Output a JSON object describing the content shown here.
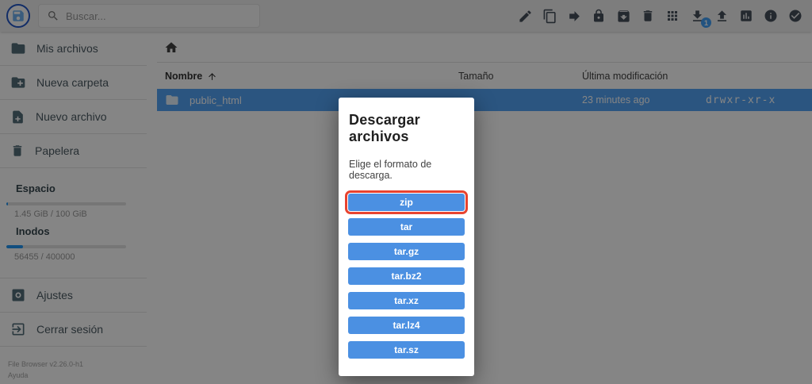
{
  "header": {
    "logo_icon": "floppy-disk-logo",
    "search": {
      "icon": "search-icon",
      "placeholder": "Buscar..."
    },
    "toolbar": {
      "icons": [
        "rename",
        "copy",
        "move",
        "lock",
        "archive",
        "delete",
        "view-grid",
        "download",
        "upload",
        "stats",
        "info",
        "select"
      ],
      "download_badge": "1"
    }
  },
  "sidebar": {
    "items": [
      {
        "icon": "folder-icon",
        "label": "Mis archivos"
      },
      {
        "icon": "new-folder-icon",
        "label": "Nueva carpeta"
      },
      {
        "icon": "new-file-icon",
        "label": "Nuevo archivo"
      },
      {
        "icon": "trash-icon",
        "label": "Papelera"
      }
    ],
    "usage": {
      "space_label": "Espacio",
      "space_value": "1.45 GiB / 100 GiB",
      "space_percent": 1.5,
      "inodes_label": "Inodos",
      "inodes_value": "56455 / 400000",
      "inodes_percent": 14.1
    },
    "settings_label": "Ajustes",
    "logout_label": "Cerrar sesión",
    "footer": {
      "version": "File Browser v2.26.0-h1",
      "help": "Ayuda"
    }
  },
  "listing": {
    "breadcrumb_icon": "home-icon",
    "columns": [
      "Nombre",
      "Tamaño",
      "Última modificación"
    ],
    "sort": {
      "column": "Nombre",
      "direction": "asc"
    },
    "rows": [
      {
        "icon": "folder-icon",
        "name": "public_html",
        "size": "",
        "modified": "23 minutes ago",
        "permissions": "drwxr-xr-x",
        "selected": true
      }
    ]
  },
  "modal": {
    "title": "Descargar archivos",
    "subtitle": "Elige el formato de descarga.",
    "formats": [
      "zip",
      "tar",
      "tar.gz",
      "tar.bz2",
      "tar.xz",
      "tar.lz4",
      "tar.sz"
    ],
    "highlighted_format": "zip"
  },
  "colors": {
    "accent_blue": "#2196f3",
    "button_blue": "#4b90e2",
    "selected_row_blue": "#53a3f6",
    "highlight_red": "#e8432f",
    "overlay": "rgba(0,0,0,0.48)"
  }
}
